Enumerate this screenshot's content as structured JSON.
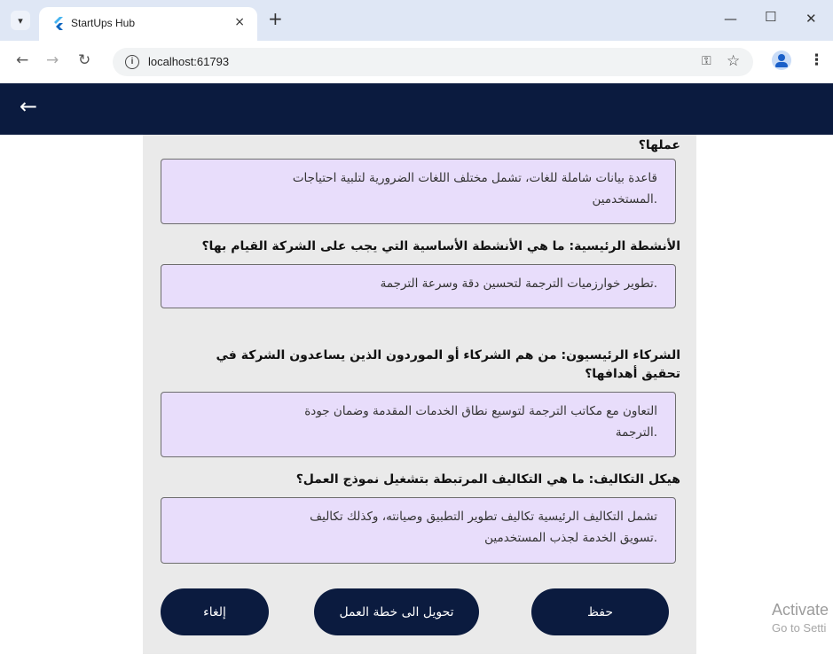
{
  "browser": {
    "tab_title": "StartUps Hub",
    "url": "localhost:61793",
    "close_glyph": "×",
    "newtab_glyph": "+"
  },
  "colors": {
    "appbar": "#0b1b3f",
    "answer_box": "#e8ddfb",
    "content_bg": "#eaeaea"
  },
  "sections": [
    {
      "question": "عملها؟",
      "answer_lines": [
        "قاعدة بيانات شاملة للغات، تشمل مختلف اللغات الضرورية لتلبية احتياجات",
        ".المستخدمين"
      ]
    },
    {
      "question": "الأنشطة الرئيسية: ما هي الأنشطة الأساسية التي يجب على الشركة القيام بها؟",
      "answer_lines": [
        ".تطوير خوارزميات الترجمة لتحسين دقة وسرعة الترجمة"
      ]
    },
    {
      "question_lines": [
        "الشركاء الرئيسيون: من هم الشركاء أو الموردون الذين يساعدون الشركة في",
        "تحقيق أهدافها؟"
      ],
      "answer_lines": [
        "التعاون مع مكاتب الترجمة لتوسيع نطاق الخدمات المقدمة وضمان جودة",
        ".الترجمة"
      ]
    },
    {
      "question": "هيكل التكاليف: ما هي التكاليف المرتبطة بتشغيل نموذج العمل؟",
      "answer_lines": [
        "تشمل التكاليف الرئيسية تكاليف تطوير التطبيق وصيانته، وكذلك تكاليف",
        ".تسويق الخدمة لجذب المستخدمين"
      ]
    }
  ],
  "buttons": {
    "save": "حفظ",
    "convert": "تحويل الى خطة العمل",
    "cancel": "إلغاء"
  },
  "watermark": {
    "line1": "Activate",
    "line2": "Go to Setti"
  }
}
